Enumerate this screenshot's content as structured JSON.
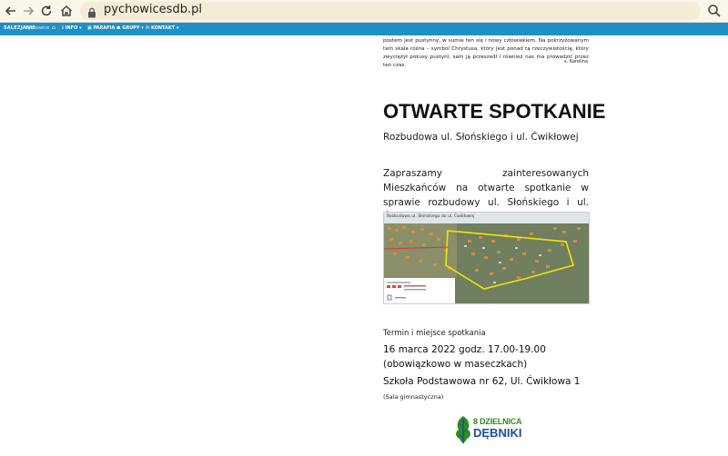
{
  "browser": {
    "url": "pychowicesdb.pl"
  },
  "site": {
    "logo": "SALEZJANIE",
    "logo_sub": "Pychowice",
    "menu": [
      "INFO",
      "PARAFIA",
      "GRUPY",
      "KONTAKT"
    ]
  },
  "prev_article": {
    "text": "postem jest pustynny, w sumie ten się i nowy człowiekiem. Na pokrzyżowanym tam skała rośna – symbol Chrystusa, który jest ponad tą rzeczywistością, który zwyciężył pokusy pustyni, sam ją przeszedł i również nas ma prowadzić przez ten czas.",
    "signature": "s. Karolina"
  },
  "article": {
    "title": "OTWARTE SPOTKANIE",
    "subtitle": "Rozbudowa ul. Słońskiego i ul. Ćwikłowej",
    "invite": "Zapraszamy zainteresowanych Mieszkańców na otwarte spotkanie w sprawie rozbudowy ul. Słońskiego i ul. Ćwikłowej.",
    "map_caption": "Rozbudowa ul. Słońskiego do ul. Ćwikłowej",
    "meeting_label": "Termin i miejsce spotkania",
    "meeting_date": "16 marca 2022 godz. 17.00-19.00",
    "meeting_note": "(obowiązkowo w maseczkach)",
    "meeting_place": "Szkoła Podstawowa nr 62, Ul. Ćwikłowa 1",
    "meeting_room": "(Sala gimnastyczna)"
  },
  "footer": {
    "logo_line1": "8 DZIELNICA",
    "logo_line2": "DĘBNIKI"
  },
  "colors": {
    "sitebar": "#1f8fc8",
    "chrome": "#fbf6ea",
    "logo_green": "#2e8b1d",
    "logo_blue": "#1b4fa0"
  }
}
